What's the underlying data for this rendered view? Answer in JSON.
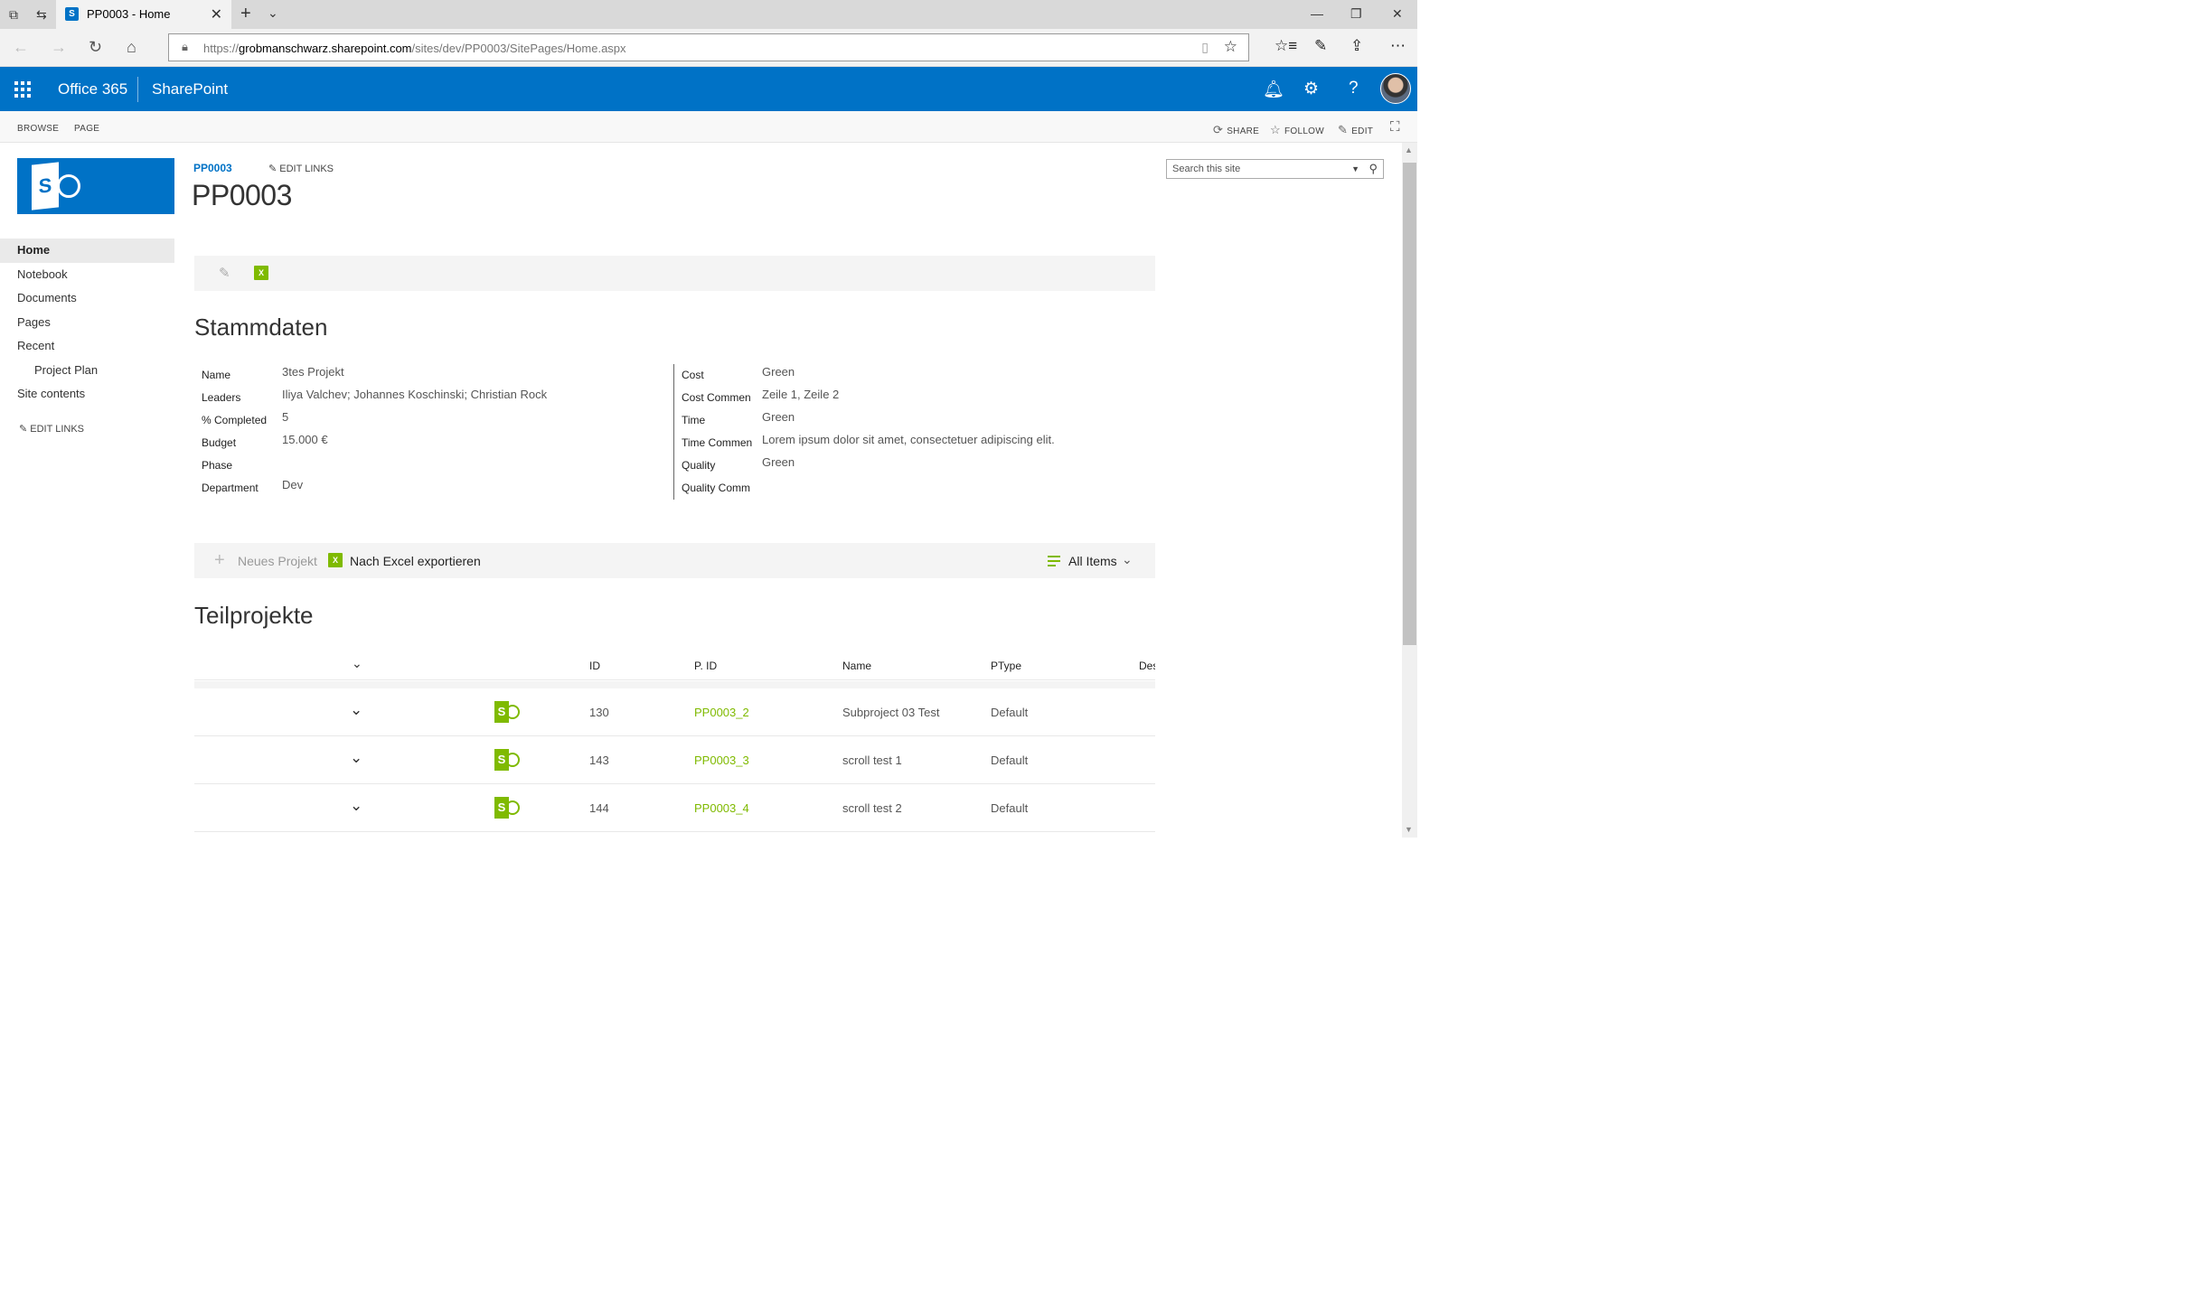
{
  "browser": {
    "tab_title": "PP0003 - Home",
    "url_prefix": "https://",
    "url_domain": "grobmanschwarz.sharepoint.com",
    "url_path": "/sites/dev/PP0003/SitePages/Home.aspx"
  },
  "suite": {
    "brand": "Office 365",
    "app": "SharePoint"
  },
  "ribbon": {
    "tabs": [
      "BROWSE",
      "PAGE"
    ],
    "share": "SHARE",
    "follow": "FOLLOW",
    "edit": "EDIT"
  },
  "nav": {
    "items": [
      "Home",
      "Notebook",
      "Documents",
      "Pages",
      "Recent",
      "Project Plan",
      "Site contents"
    ],
    "edit_links": "EDIT LINKS"
  },
  "header": {
    "breadcrumb": "PP0003",
    "edit_links": "EDIT LINKS",
    "title": "PP0003"
  },
  "search": {
    "placeholder": "Search this site"
  },
  "stammdaten": {
    "heading": "Stammdaten",
    "left": [
      {
        "label": "Name",
        "value": "3tes Projekt"
      },
      {
        "label": "Leaders",
        "value": "Iliya Valchev; Johannes Koschinski; Christian Rock"
      },
      {
        "label": "% Completed",
        "value": "5"
      },
      {
        "label": "Budget",
        "value": "15.000 €"
      },
      {
        "label": "Phase",
        "value": ""
      },
      {
        "label": "Department",
        "value": "Dev"
      }
    ],
    "right": [
      {
        "label": "Cost",
        "value": "Green"
      },
      {
        "label": "Cost Commen",
        "value": "Zeile 1, Zeile 2"
      },
      {
        "label": "Time",
        "value": "Green"
      },
      {
        "label": "Time Commen",
        "value": "Lorem ipsum dolor sit amet, consectetuer adipiscing elit."
      },
      {
        "label": "Quality",
        "value": "Green"
      },
      {
        "label": "Quality Comm",
        "value": ""
      }
    ]
  },
  "list_toolbar": {
    "new_label": "Neues Projekt",
    "export_label": "Nach Excel exportieren",
    "view_label": "All Items"
  },
  "teilprojekte": {
    "heading": "Teilprojekte",
    "columns": [
      "ID",
      "P. ID",
      "Name",
      "PType",
      "Des"
    ],
    "rows": [
      {
        "id": "130",
        "pid": "PP0003_2",
        "name": "Subproject 03 Test",
        "ptype": "Default"
      },
      {
        "id": "143",
        "pid": "PP0003_3",
        "name": "scroll test 1",
        "ptype": "Default"
      },
      {
        "id": "144",
        "pid": "PP0003_4",
        "name": "scroll test 2",
        "ptype": "Default"
      }
    ]
  },
  "colors": {
    "suite_blue": "#0072c6",
    "accent_green": "#7fba00"
  }
}
